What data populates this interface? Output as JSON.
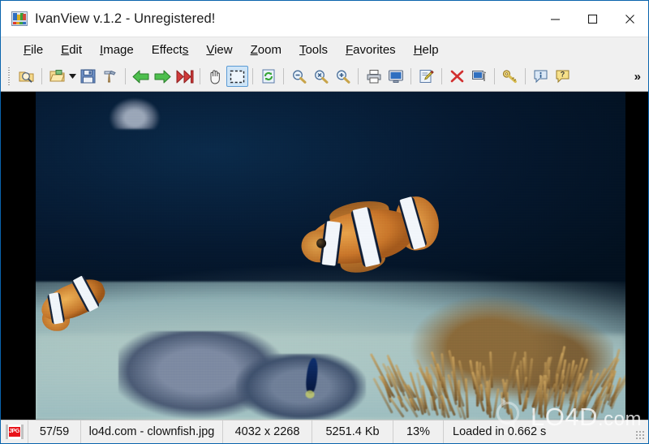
{
  "window": {
    "title": "IvanView v.1.2 - Unregistered!",
    "app_icon": "ivanview-logo-icon",
    "border_color": "#0a64ad",
    "chrome_color": "#f0f0f0"
  },
  "window_controls": {
    "minimize": "minimize-icon",
    "maximize": "maximize-icon",
    "close": "close-icon"
  },
  "menubar": {
    "items": [
      {
        "label": "File",
        "accel": "F"
      },
      {
        "label": "Edit",
        "accel": "E"
      },
      {
        "label": "Image",
        "accel": "I"
      },
      {
        "label": "Effects",
        "accel": "s"
      },
      {
        "label": "View",
        "accel": "V"
      },
      {
        "label": "Zoom",
        "accel": "Z"
      },
      {
        "label": "Tools",
        "accel": "T"
      },
      {
        "label": "Favorites",
        "accel": "F"
      },
      {
        "label": "Help",
        "accel": "H"
      }
    ]
  },
  "toolbar": {
    "overflow_label": "»",
    "buttons": [
      {
        "name": "browse-thumbnails-icon",
        "tip": "Browse"
      },
      {
        "name": "open-file-icon",
        "tip": "Open"
      },
      {
        "name": "open-dropdown-arrow-icon",
        "tip": "Recent files"
      },
      {
        "name": "save-icon",
        "tip": "Save"
      },
      {
        "name": "build-tools-icon",
        "tip": "Tools"
      },
      {
        "name": "previous-image-icon",
        "tip": "Previous"
      },
      {
        "name": "next-image-icon",
        "tip": "Next"
      },
      {
        "name": "slideshow-icon",
        "tip": "Slideshow"
      },
      {
        "name": "pan-hand-icon",
        "tip": "Pan"
      },
      {
        "name": "marquee-select-icon",
        "tip": "Select",
        "active": true
      },
      {
        "name": "refresh-icon",
        "tip": "Refresh"
      },
      {
        "name": "zoom-out-icon",
        "tip": "Zoom out"
      },
      {
        "name": "zoom-actual-icon",
        "tip": "Actual size"
      },
      {
        "name": "zoom-in-icon",
        "tip": "Zoom in"
      },
      {
        "name": "print-icon",
        "tip": "Print"
      },
      {
        "name": "fullscreen-monitor-icon",
        "tip": "Full screen"
      },
      {
        "name": "edit-note-icon",
        "tip": "Edit"
      },
      {
        "name": "delete-icon",
        "tip": "Delete"
      },
      {
        "name": "set-wallpaper-icon",
        "tip": "Set as wallpaper"
      },
      {
        "name": "key-register-icon",
        "tip": "Register"
      },
      {
        "name": "about-info-icon",
        "tip": "About"
      },
      {
        "name": "help-icon",
        "tip": "Help"
      }
    ]
  },
  "viewport": {
    "name": "image-canvas",
    "background": "#000000",
    "photo_alt": "clownfish in aquarium reef"
  },
  "statusbar": {
    "format_badge": "JPG",
    "counter": "57/59",
    "filename": "lo4d.com - clownfish.jpg",
    "dimensions": "4032 x 2268",
    "filesize": "5251.4 Kb",
    "zoom": "13%",
    "status": "Loaded in 0.662 s"
  },
  "watermark": {
    "text": "LO4D",
    "suffix": ".com",
    "logo": "refresh-circle-icon"
  }
}
